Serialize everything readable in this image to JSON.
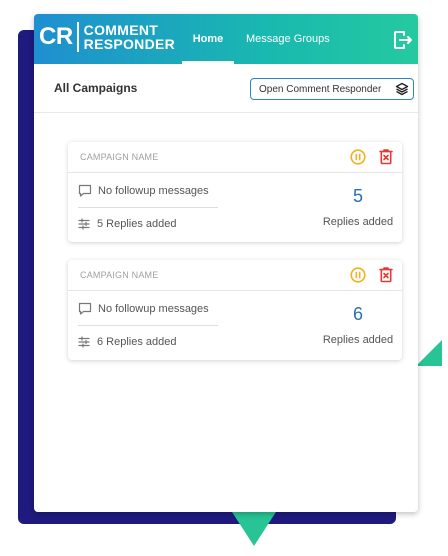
{
  "header": {
    "logo_mark": "CR",
    "logo_line1": "COMMENT",
    "logo_line2": "RESPONDER",
    "nav": [
      {
        "label": "Home",
        "active": true
      },
      {
        "label": "Message Groups",
        "active": false
      }
    ]
  },
  "toolbar": {
    "title": "All Campaigns",
    "open_button_label": "Open Comment Responder"
  },
  "campaigns": [
    {
      "name": "CAMPAIGN NAME",
      "followup": "No followup messages",
      "replies_text": "5 Replies added",
      "replies_count": "5",
      "replies_label": "Replies added"
    },
    {
      "name": "CAMPAIGN NAME",
      "followup": "No followup messages",
      "replies_text": "6 Replies added",
      "replies_count": "6",
      "replies_label": "Replies added"
    }
  ],
  "colors": {
    "navy": "#1f1a7e",
    "accent_green": "#28c495",
    "count_blue": "#2b6fb5",
    "pause_yellow": "#f2b01e",
    "delete_red": "#e03a3a"
  },
  "icons": [
    "logout-icon",
    "layers-icon",
    "pause-icon",
    "delete-icon",
    "message-icon",
    "sliders-icon"
  ]
}
